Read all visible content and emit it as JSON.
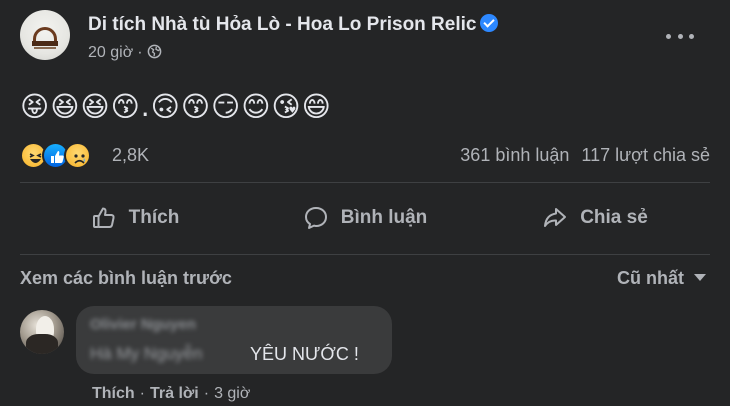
{
  "post": {
    "page_name": "Di tích Nhà tù Hỏa Lò - Hoa Lo Prison Relic",
    "time": "20 giờ",
    "privacy_icon": "globe-icon",
    "text": "😝😆😆😙.🙃😙😏😊😘😄",
    "reaction_count": "2,8K",
    "comments_count": "361 bình luận",
    "shares_count": "117 lượt chia sẻ",
    "reactions": [
      "haha",
      "like",
      "sad"
    ]
  },
  "actions": {
    "like": "Thích",
    "comment": "Bình luận",
    "share": "Chia sẻ"
  },
  "comments_bar": {
    "view_previous": "Xem các bình luận trước",
    "sort": "Cũ nhất"
  },
  "comment": {
    "author": "Olivier Nguyen",
    "tagged": "Hà My Nguyễn",
    "text": "YÊU NƯỚC !",
    "like": "Thích",
    "reply": "Trả lời",
    "time": "3 giờ"
  },
  "colors": {
    "background": "#242526",
    "verified": "#2d88ff",
    "secondary_text": "#b0b3b8",
    "bubble": "#3a3b3c"
  }
}
